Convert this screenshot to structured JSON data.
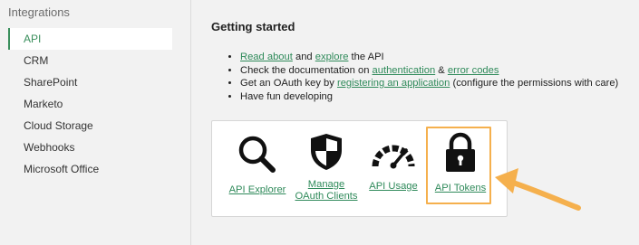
{
  "sidebar": {
    "title": "Integrations",
    "items": [
      {
        "label": "API",
        "active": true
      },
      {
        "label": "CRM"
      },
      {
        "label": "SharePoint"
      },
      {
        "label": "Marketo"
      },
      {
        "label": "Cloud Storage"
      },
      {
        "label": "Webhooks"
      },
      {
        "label": "Microsoft Office"
      }
    ]
  },
  "main": {
    "heading": "Getting started",
    "steps": {
      "s1_link1": "Read about",
      "s1_and": " and ",
      "s1_link2": "explore",
      "s1_tail": " the API",
      "s2_text": "Check the documentation on ",
      "s2_link1": "authentication",
      "s2_amp": " & ",
      "s2_link2": "error codes",
      "s3_text": "Get an OAuth key by ",
      "s3_link": "registering an application",
      "s3_tail": " (configure the permissions with care)",
      "s4_text": "Have fun developing"
    },
    "tools": [
      {
        "label": "API Explorer",
        "icon": "magnifier-icon"
      },
      {
        "label_line1": "Manage",
        "label_line2": "OAuth Clients",
        "icon": "shield-icon"
      },
      {
        "label": "API Usage",
        "icon": "gauge-icon"
      },
      {
        "label": "API Tokens",
        "icon": "padlock-icon"
      }
    ]
  },
  "colors": {
    "accent": "#2f8a5a",
    "highlight": "#f5b04d",
    "background": "#f2f2f2"
  }
}
